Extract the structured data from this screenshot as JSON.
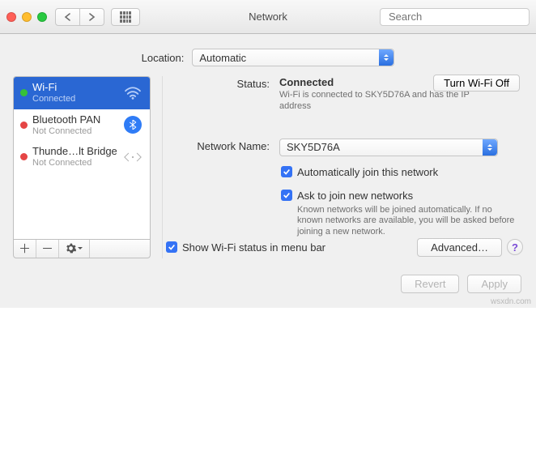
{
  "window": {
    "title": "Network",
    "search_placeholder": "Search"
  },
  "location": {
    "label": "Location:",
    "value": "Automatic"
  },
  "services": [
    {
      "name": "Wi-Fi",
      "status": "Connected",
      "dot": "green",
      "icon": "wifi",
      "selected": true
    },
    {
      "name": "Bluetooth PAN",
      "status": "Not Connected",
      "dot": "red",
      "icon": "bluetooth",
      "selected": false
    },
    {
      "name": "Thunde…lt Bridge",
      "status": "Not Connected",
      "dot": "red",
      "icon": "thunderbolt-bridge",
      "selected": false
    }
  ],
  "sidebar_buttons": {
    "add": "＋",
    "remove": "－"
  },
  "detail": {
    "status_label": "Status:",
    "status_value": "Connected",
    "status_sub": "Wi-Fi is connected to SKY5D76A and has the IP address",
    "toggle_label": "Turn Wi-Fi Off",
    "network_label": "Network Name:",
    "network_value": "SKY5D76A",
    "auto_join": "Automatically join this network",
    "ask_join": "Ask to join new networks",
    "ask_join_sub": "Known networks will be joined automatically. If no known networks are available, you will be asked before joining a new network.",
    "show_menubar": "Show Wi-Fi status in menu bar",
    "advanced": "Advanced…",
    "help": "?"
  },
  "buttons": {
    "revert": "Revert",
    "apply": "Apply"
  },
  "watermark": "wsxdn.com"
}
